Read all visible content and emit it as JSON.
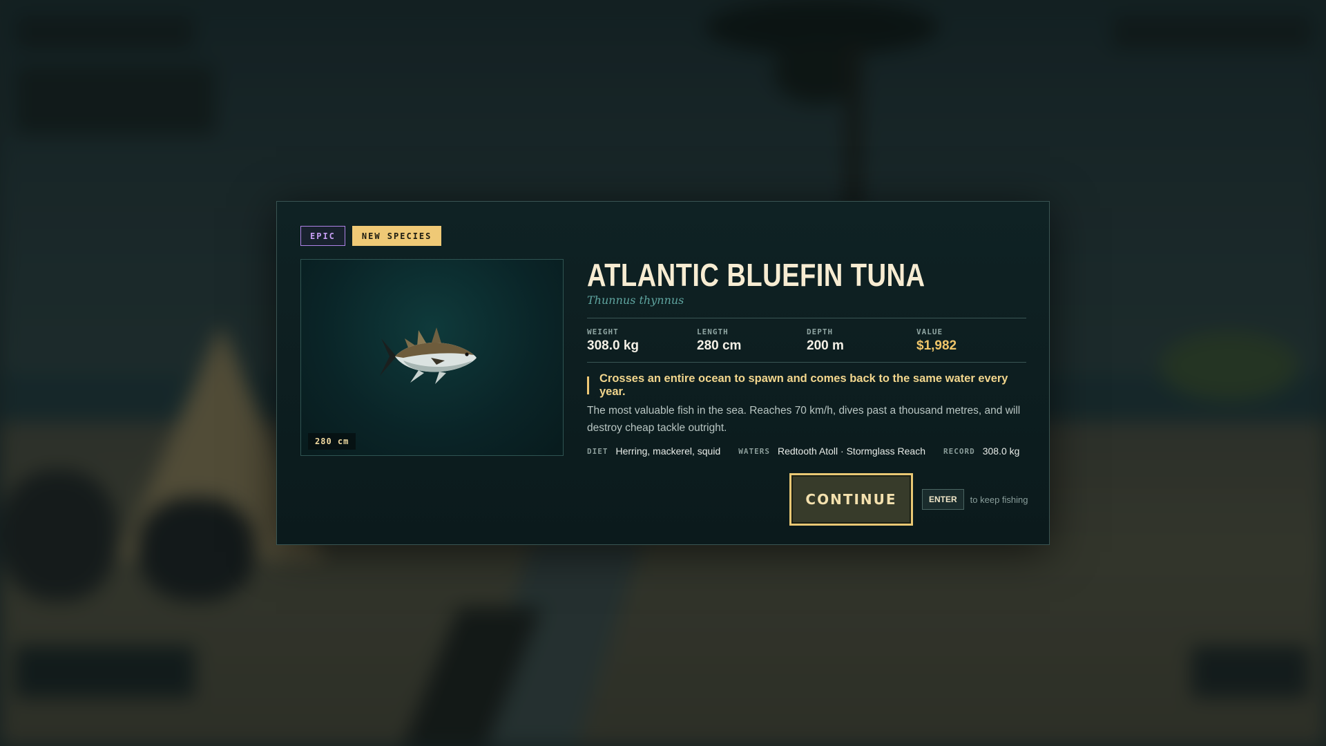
{
  "catch_card": {
    "tags": {
      "rarity": "EPIC",
      "new_species": "NEW SPECIES"
    },
    "size_badge": "280 cm",
    "name": "ATLANTIC BLUEFIN TUNA",
    "scientific_name": "Thunnus thynnus",
    "stats": [
      {
        "label": "WEIGHT",
        "value": "308.0 kg"
      },
      {
        "label": "LENGTH",
        "value": "280 cm"
      },
      {
        "label": "DEPTH",
        "value": "200 m"
      },
      {
        "label": "VALUE",
        "value": "$1,982"
      }
    ],
    "fact": "Crosses an entire ocean to spawn and comes back to the same water every year.",
    "description": "The most valuable fish in the sea. Reaches 70 km/h, dives past a thousand metres, and will destroy cheap tackle outright.",
    "meta": {
      "diet_label": "DIET",
      "diet": "Herring, mackerel, squid",
      "waters_label": "WATERS",
      "waters": "Redtooth Atoll · Stormglass Reach",
      "record_label": "RECORD",
      "record": "308.0 kg"
    },
    "continue_label": "CONTINUE",
    "key_label": "ENTER",
    "key_hint": "to keep fishing"
  },
  "colors": {
    "accent_gold": "#efc976",
    "epic_purple": "#b083e8",
    "value_gold": "#f0c66a",
    "scientific_teal": "#5fa5a0"
  }
}
